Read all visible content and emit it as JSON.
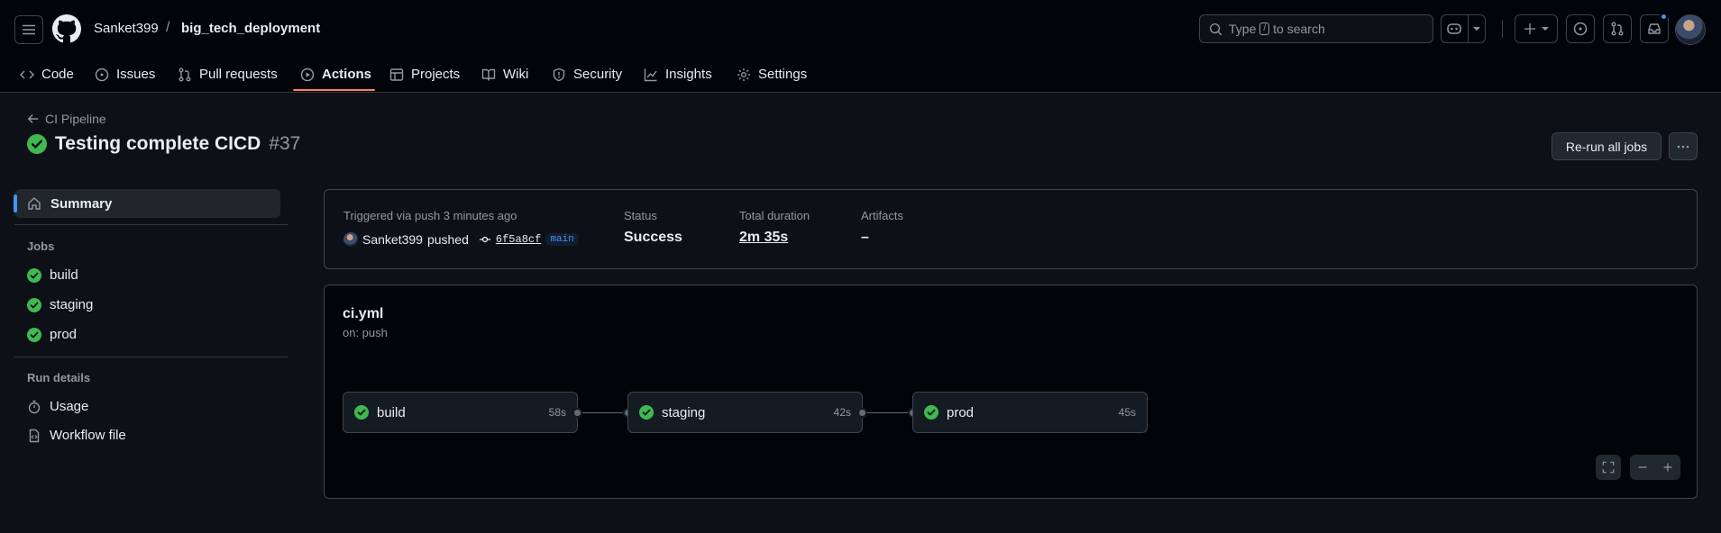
{
  "header": {
    "owner": "Sanket399",
    "separator": "/",
    "repo": "big_tech_deployment",
    "search_placeholder_pre": "Type",
    "search_key": "/",
    "search_placeholder_post": "to search"
  },
  "tabs": [
    {
      "label": "Code",
      "icon": "code-icon"
    },
    {
      "label": "Issues",
      "icon": "issue-opened-icon"
    },
    {
      "label": "Pull requests",
      "icon": "git-pull-request-icon"
    },
    {
      "label": "Actions",
      "icon": "play-icon",
      "active": true
    },
    {
      "label": "Projects",
      "icon": "table-icon"
    },
    {
      "label": "Wiki",
      "icon": "book-icon"
    },
    {
      "label": "Security",
      "icon": "shield-icon"
    },
    {
      "label": "Insights",
      "icon": "graph-icon"
    },
    {
      "label": "Settings",
      "icon": "gear-icon"
    }
  ],
  "run": {
    "back_label": "CI Pipeline",
    "title": "Testing complete CICD",
    "number": "#37",
    "rerun_label": "Re-run all jobs"
  },
  "sidebar": {
    "summary_label": "Summary",
    "jobs_heading": "Jobs",
    "jobs": [
      "build",
      "staging",
      "prod"
    ],
    "details_heading": "Run details",
    "details": [
      {
        "label": "Usage",
        "icon": "stopwatch-icon"
      },
      {
        "label": "Workflow file",
        "icon": "file-code-icon"
      }
    ]
  },
  "summary": {
    "trigger_label": "Triggered via push 3 minutes ago",
    "actor": "Sanket399",
    "action": "pushed",
    "sha": "6f5a8cf",
    "branch": "main",
    "status_label": "Status",
    "status_value": "Success",
    "duration_label": "Total duration",
    "duration_value": "2m 35s",
    "artifacts_label": "Artifacts",
    "artifacts_value": "–"
  },
  "workflow": {
    "file": "ci.yml",
    "trigger": "on: push",
    "jobs": [
      {
        "name": "build",
        "duration": "58s",
        "status": "success"
      },
      {
        "name": "staging",
        "duration": "42s",
        "status": "success"
      },
      {
        "name": "prod",
        "duration": "45s",
        "status": "success"
      }
    ]
  },
  "colors": {
    "success": "#3fb950",
    "accent": "#4493f8",
    "active_tab": "#f78166"
  }
}
